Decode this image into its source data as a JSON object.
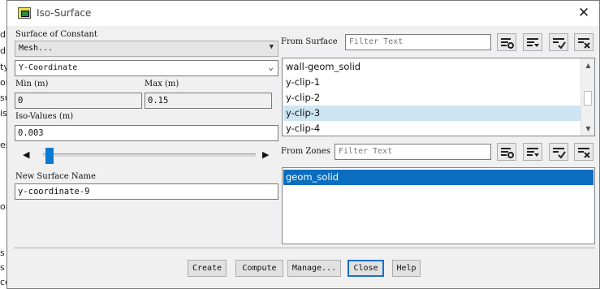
{
  "background": {
    "snippets": [
      "diti",
      "diti",
      "ty-",
      "om",
      "su",
      "iso",
      "es",
      "on",
      "s",
      "s",
      "ce"
    ]
  },
  "window": {
    "title": "Iso-Surface",
    "icon": "fluent-app-icon",
    "close_glyph": "✕"
  },
  "left": {
    "surface_of_constant_label": "Surface of Constant",
    "category_value": "Mesh...",
    "field_value": "Y-Coordinate",
    "min_label": "Min (m)",
    "min_value": "0",
    "max_label": "Max (m)",
    "max_value": "0.15",
    "iso_values_label": "Iso-Values (m)",
    "iso_values_value": "0.003",
    "slider_left_glyph": "◀",
    "slider_right_glyph": "▶",
    "slider_fraction": 0.02,
    "new_surface_label": "New Surface Name",
    "new_surface_value": "y-coordinate-9"
  },
  "from_surface": {
    "label": "From Surface",
    "filter_placeholder": "Filter Text",
    "items": [
      {
        "label": "wall-geom_solid",
        "selected": false
      },
      {
        "label": "y-clip-1",
        "selected": false
      },
      {
        "label": "y-clip-2",
        "selected": false
      },
      {
        "label": "y-clip-3",
        "selected": true
      },
      {
        "label": "y-clip-4",
        "selected": false
      }
    ],
    "toolbar_icons": [
      "select-all-icon",
      "filter-menu-icon",
      "check-selected-icon",
      "deselect-all-icon"
    ]
  },
  "from_zones": {
    "label": "From Zones",
    "filter_placeholder": "Filter Text",
    "items": [
      {
        "label": "geom_solid",
        "selected": true
      }
    ],
    "toolbar_icons": [
      "select-all-icon",
      "filter-menu-icon",
      "check-selected-icon",
      "deselect-all-icon"
    ]
  },
  "buttons": {
    "create": "Create",
    "compute": "Compute",
    "manage": "Manage...",
    "close": "Close",
    "help": "Help"
  },
  "colors": {
    "selection_blue": "#0a6dbf",
    "selection_light": "#cde4f3",
    "slider_thumb": "#0a7bd4",
    "default_button_border": "#1a6fc9"
  }
}
